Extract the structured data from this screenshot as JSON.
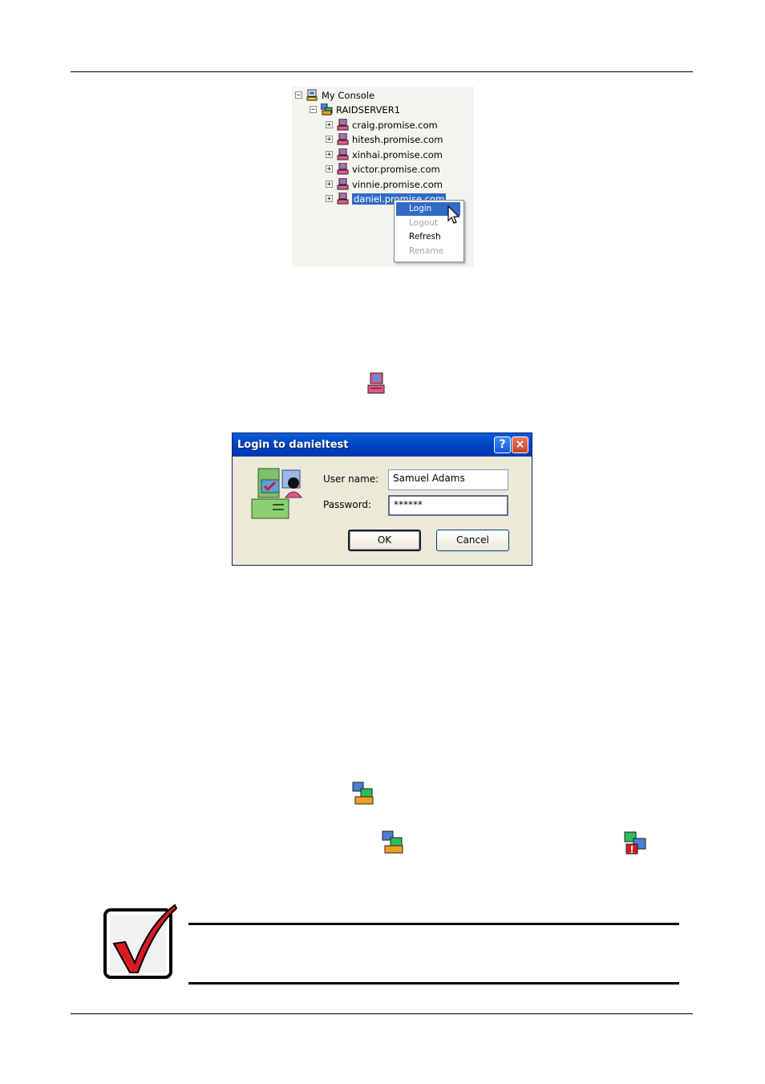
{
  "tree": {
    "root": "My Console",
    "server": "RAIDSERVER1",
    "hosts": [
      "craig.promise.com",
      "hitesh.promise.com",
      "xinhai.promise.com",
      "victor.promise.com",
      "vinnie.promise.com",
      "daniel.promise.com"
    ],
    "expander_collapsed": "+",
    "expander_expanded": "−"
  },
  "context_menu": {
    "items": [
      "Login",
      "Logout",
      "Refresh",
      "Rename"
    ]
  },
  "dialog": {
    "title": "Login to danieltest",
    "help_button": "?",
    "close_button": "×",
    "username_label": "User name:",
    "username_value": "Samuel Adams",
    "password_label": "Password:",
    "password_value": "******",
    "ok_label": "OK",
    "cancel_label": "Cancel"
  },
  "colors": {
    "selection": "#316ac5",
    "titlebar": "#0a5ddc",
    "dialog_bg": "#ece9d8",
    "checkmark": "#d81b23"
  },
  "icons": [
    "console-icon",
    "server-icon",
    "host-icon",
    "login-computer-icon",
    "network-icon",
    "network-alert-icon",
    "checkmark-note-icon"
  ]
}
